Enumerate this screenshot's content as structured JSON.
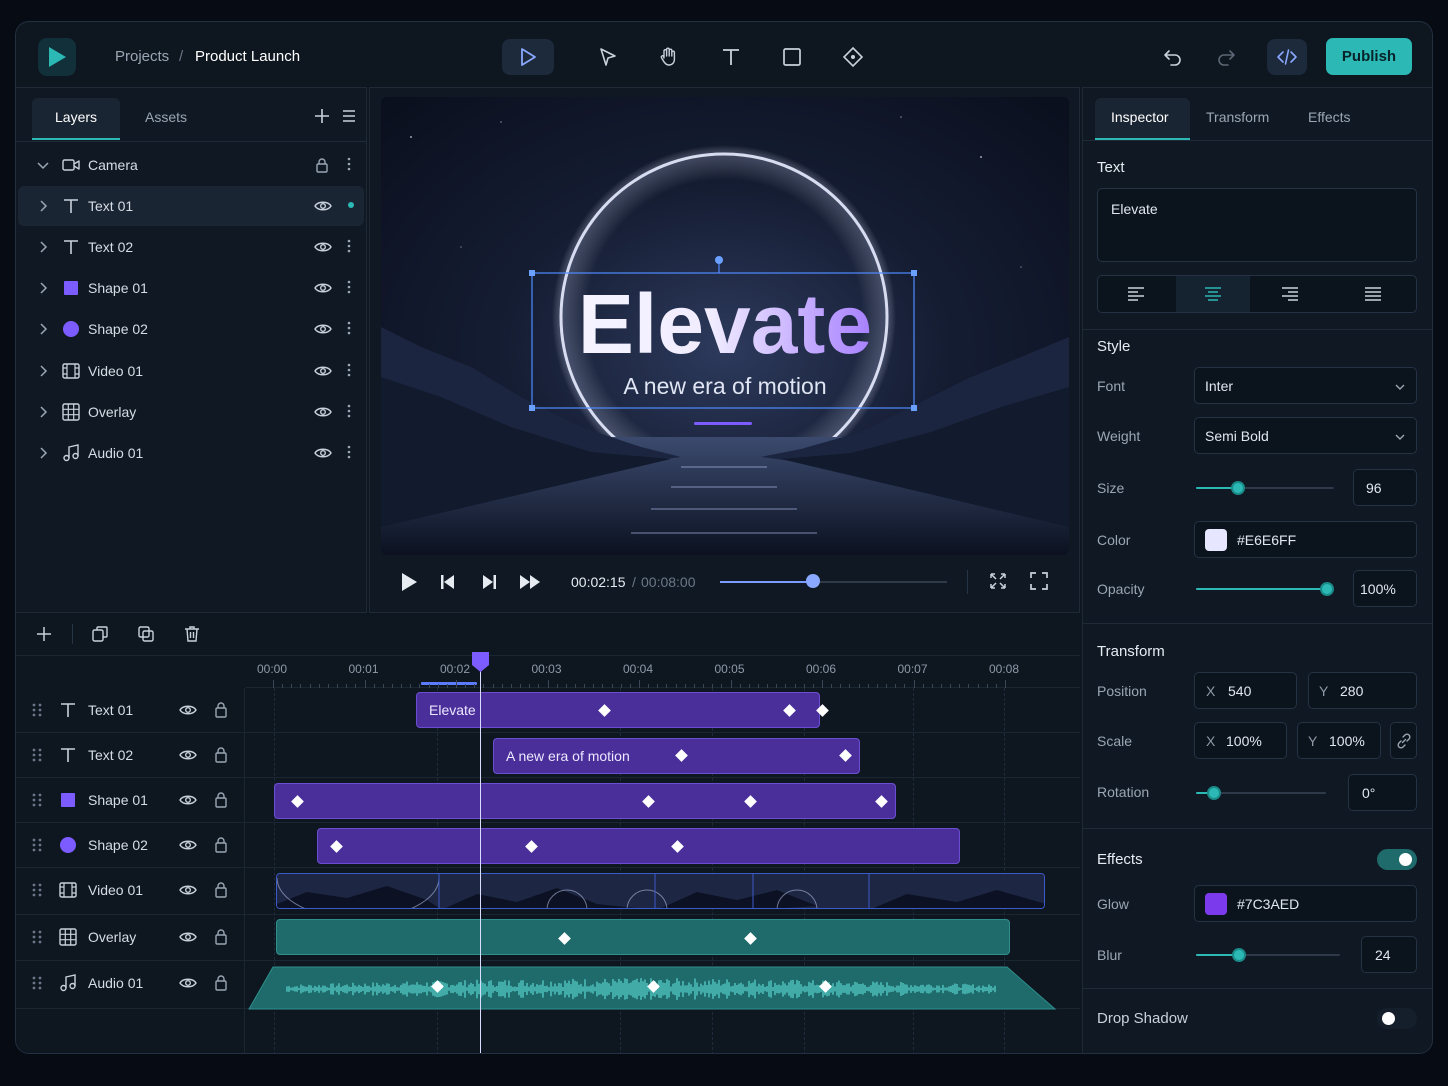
{
  "breadcrumb": {
    "root": "Projects",
    "separator": "/",
    "current": "Product Launch"
  },
  "toolbar": {
    "tools": [
      "play-tool-icon",
      "select-tool-icon",
      "hand-tool-icon",
      "text-tool-icon",
      "rectangle-tool-icon",
      "keyframe-tool-icon"
    ],
    "publish_label": "Publish"
  },
  "layers_panel": {
    "tabs": [
      "Layers",
      "Assets"
    ],
    "items": [
      {
        "name": "Camera",
        "icon": "camera-icon"
      },
      {
        "name": "Text 01",
        "icon": "text-icon"
      },
      {
        "name": "Text 02",
        "icon": "text-icon"
      },
      {
        "name": "Shape 01",
        "icon": "square-shape-icon"
      },
      {
        "name": "Shape 02",
        "icon": "circle-shape-icon"
      },
      {
        "name": "Video 01",
        "icon": "film-icon"
      },
      {
        "name": "Overlay",
        "icon": "grid-icon"
      },
      {
        "name": "Audio 01",
        "icon": "music-note-icon"
      }
    ]
  },
  "preview": {
    "title": "Elevate",
    "subtitle": "A new era of motion",
    "current_time": "00:02:15",
    "time_separator": "/",
    "total_time": "00:08:00",
    "progress": 0.41
  },
  "inspector": {
    "tabs": [
      "Inspector",
      "Transform",
      "Effects"
    ],
    "text_section": "Text",
    "text_value": "Elevate",
    "style_section": "Style",
    "font_label": "Font",
    "font_value": "Inter",
    "weight_label": "Weight",
    "weight_value": "Semi Bold",
    "size_label": "Size",
    "size_value": "96",
    "color_label": "Color",
    "color_value": "#E6E6FF",
    "opacity_label": "Opacity",
    "opacity_value": "100%",
    "transform_section": "Transform",
    "position_label": "Position",
    "pos_x_label": "X",
    "pos_x": "540",
    "pos_y_label": "Y",
    "pos_y": "280",
    "scale_label": "Scale",
    "scale_x_label": "X",
    "scale_x": "100%",
    "scale_y_label": "Y",
    "scale_y": "100%",
    "rotation_label": "Rotation",
    "rotation_value": "0°",
    "effects_section": "Effects",
    "glow_label": "Glow",
    "glow_value": "#7C3AED",
    "blur_label": "Blur",
    "blur_value": "24",
    "drop_shadow_label": "Drop Shadow",
    "effects_enabled": true,
    "drop_shadow_enabled": false
  },
  "timeline": {
    "ticks": [
      "00:00",
      "00:01",
      "00:02",
      "00:03",
      "00:04",
      "00:05",
      "00:06",
      "00:07",
      "00:08"
    ],
    "tracks": [
      {
        "name": "Text 01",
        "icon": "text-icon",
        "clip_label": "Elevate"
      },
      {
        "name": "Text 02",
        "icon": "text-icon",
        "clip_label": "A new era of motion"
      },
      {
        "name": "Shape 01",
        "icon": "square-shape-icon"
      },
      {
        "name": "Shape 02",
        "icon": "circle-shape-icon"
      },
      {
        "name": "Video 01",
        "icon": "film-icon"
      },
      {
        "name": "Overlay",
        "icon": "grid-icon"
      },
      {
        "name": "Audio 01",
        "icon": "music-note-icon"
      }
    ]
  },
  "colors": {
    "accent": "#2cb8b5",
    "clip_purple": "#4a2f9a",
    "clip_teal": "#1f6b6b",
    "playhead": "#7c5cff"
  }
}
